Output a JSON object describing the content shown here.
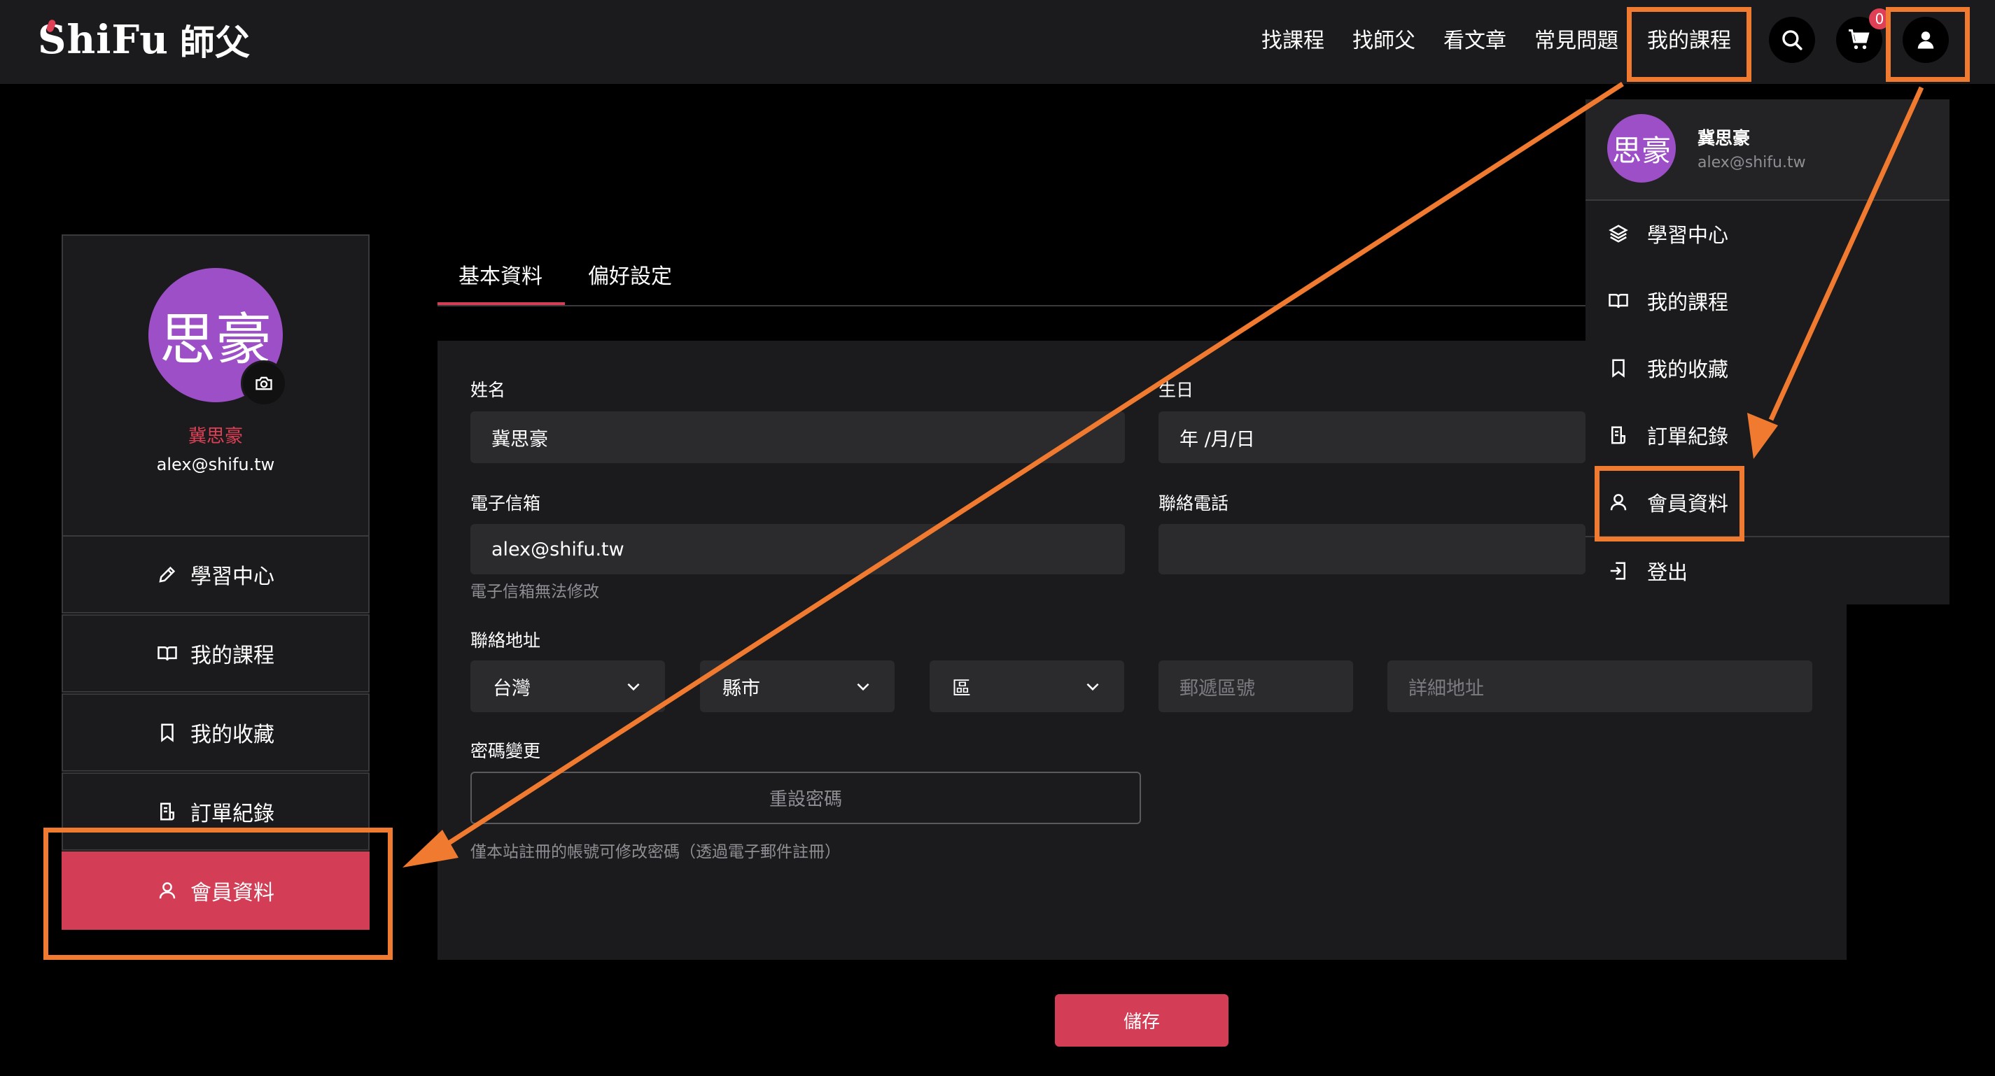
{
  "header": {
    "brand": "ShiFu",
    "brand_cn": "師父",
    "nav": [
      "找課程",
      "找師父",
      "看文章",
      "常見問題",
      "我的課程"
    ],
    "cart_count": "0"
  },
  "profile": {
    "avatar_text": "思豪",
    "name": "冀思豪",
    "email": "alex@shifu.tw"
  },
  "sidebar": {
    "items": [
      {
        "label": "學習中心",
        "icon": "pencil-icon"
      },
      {
        "label": "我的課程",
        "icon": "book-icon"
      },
      {
        "label": "我的收藏",
        "icon": "bookmark-icon"
      },
      {
        "label": "訂單紀錄",
        "icon": "receipt-icon"
      },
      {
        "label": "會員資料",
        "icon": "user-icon"
      }
    ]
  },
  "tabs": [
    "基本資料",
    "偏好設定"
  ],
  "form": {
    "name_label": "姓名",
    "name_value": "冀思豪",
    "birthday_label": "生日",
    "birthday_value": "年 /月/日",
    "email_label": "電子信箱",
    "email_value": "alex@shifu.tw",
    "email_hint": "電子信箱無法修改",
    "phone_label": "聯絡電話",
    "phone_value": "",
    "address_label": "聯絡地址",
    "country_value": "台灣",
    "city_value": "縣市",
    "district_value": "區",
    "zipcode_placeholder": "郵遞區號",
    "address_placeholder": "詳細地址",
    "password_label": "密碼變更",
    "reset_password_label": "重設密碼",
    "password_hint": "僅本站註冊的帳號可修改密碼（透過電子郵件註冊）",
    "save_label": "儲存"
  },
  "dropdown": {
    "name": "冀思豪",
    "email": "alex@shifu.tw",
    "avatar_text": "思豪",
    "items": [
      {
        "label": "學習中心",
        "icon": "layers-icon"
      },
      {
        "label": "我的課程",
        "icon": "book-icon"
      },
      {
        "label": "我的收藏",
        "icon": "bookmark-icon"
      },
      {
        "label": "訂單紀錄",
        "icon": "receipt-icon"
      },
      {
        "label": "會員資料",
        "icon": "user-icon"
      },
      {
        "label": "登出",
        "icon": "logout-icon"
      }
    ]
  },
  "colors": {
    "accent": "#d33d55",
    "annotation": "#f07a2f",
    "panel": "#1b1b1d",
    "avatar": "#9c4fc7"
  }
}
